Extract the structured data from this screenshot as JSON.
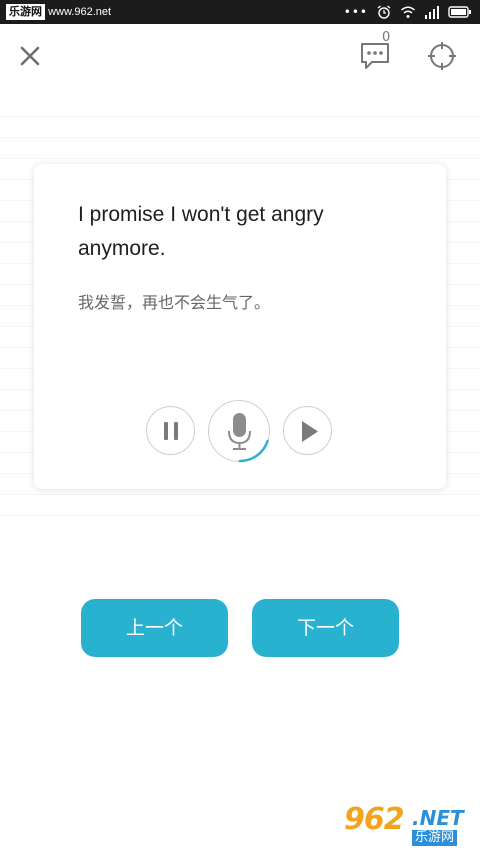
{
  "status_bar": {
    "site_badge": "乐游网",
    "site_url": "www.962.net",
    "more_dots": "•••"
  },
  "top_bar": {
    "chat_count": "0",
    "icons": [
      "close-icon",
      "chat-icon",
      "target-icon"
    ]
  },
  "card": {
    "english_sentence": "I promise I won't get angry anymore.",
    "chinese_translation": "我发誓，再也不会生气了。",
    "controls": [
      "pause-icon",
      "mic-icon",
      "play-icon"
    ],
    "record_progress": 0.2
  },
  "navigation": {
    "prev_label": "上一个",
    "next_label": "下一个"
  },
  "watermark": {
    "number": "962",
    "suffix": ".NET",
    "name": "乐游网"
  },
  "colors": {
    "accent": "#29b2d0",
    "status_bar": "#1c1c1c",
    "watermark_orange": "#f2a41c",
    "watermark_blue": "#2c8fd8"
  }
}
